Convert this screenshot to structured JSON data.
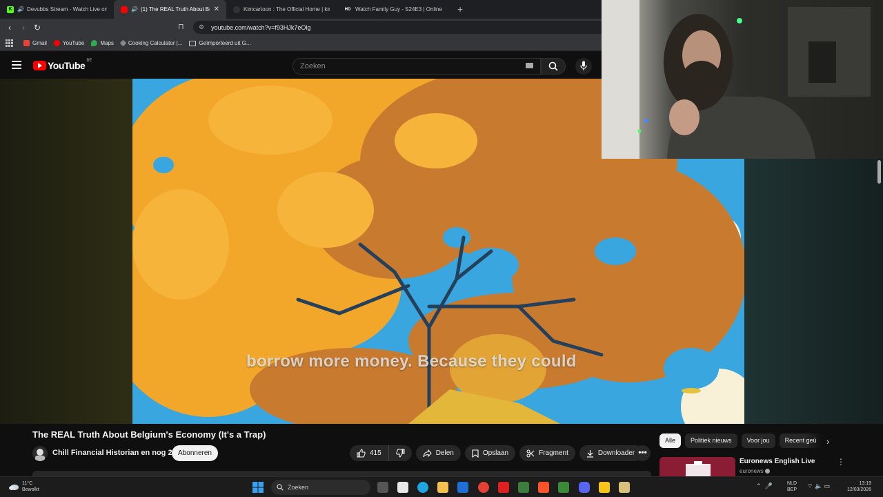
{
  "browser": {
    "tabs": [
      {
        "label": "Devubbs Stream - Watch Live on",
        "favicon_color": "#53fc18",
        "favicon_char": "K",
        "active": false,
        "audio": true
      },
      {
        "label": "(1) The REAL Truth About Be",
        "favicon_color": "#ff0000",
        "favicon_char": "",
        "active": true,
        "audio": true
      },
      {
        "label": "Kimcartoon : The Official Home | kim",
        "favicon_color": "#222222",
        "favicon_char": "",
        "active": false,
        "audio": false
      },
      {
        "label": "Watch Family Guy - S24E3 | Online H",
        "favicon_color": "#111111",
        "favicon_char": "HD",
        "active": false,
        "audio": false
      }
    ],
    "new_tab": "+",
    "url": "youtube.com/watch?v=f93HJk7eOlg"
  },
  "bookmarks": [
    {
      "label": "Gmail",
      "color": "#ea4335"
    },
    {
      "label": "YouTube",
      "color": "#ff0000"
    },
    {
      "label": "Maps",
      "color": "#34a853"
    },
    {
      "label": "Cooking Calculator |...",
      "color": "#888888"
    },
    {
      "label": "Geïmporteerd uit G...",
      "color": "folder"
    }
  ],
  "youtube": {
    "logo": "YouTube",
    "region": "BE",
    "search_placeholder": "Zoeken"
  },
  "video": {
    "subtitle": "borrow more money. Because they could",
    "title": "The REAL Truth About Belgium's Economy (It's a Trap)",
    "channel": "Chill Financial Historian en nog 2",
    "subscribe": "Abonneren",
    "likes": "415",
    "share": "Delen",
    "save": "Opslaan",
    "clip": "Fragment",
    "download": "Downloaden",
    "more": "•••"
  },
  "chips": [
    "Alle",
    "Politiek nieuws",
    "Voor jou",
    "Recent geü"
  ],
  "recommendation": {
    "title": "Euronews English Live",
    "channel": "euronews"
  },
  "taskbar": {
    "temp": "11°C",
    "weather": "Bewolkt",
    "search": "Zoeken",
    "lang1": "NLD",
    "lang2": "BEP",
    "time": "13:19",
    "date": "12/03/2026"
  }
}
